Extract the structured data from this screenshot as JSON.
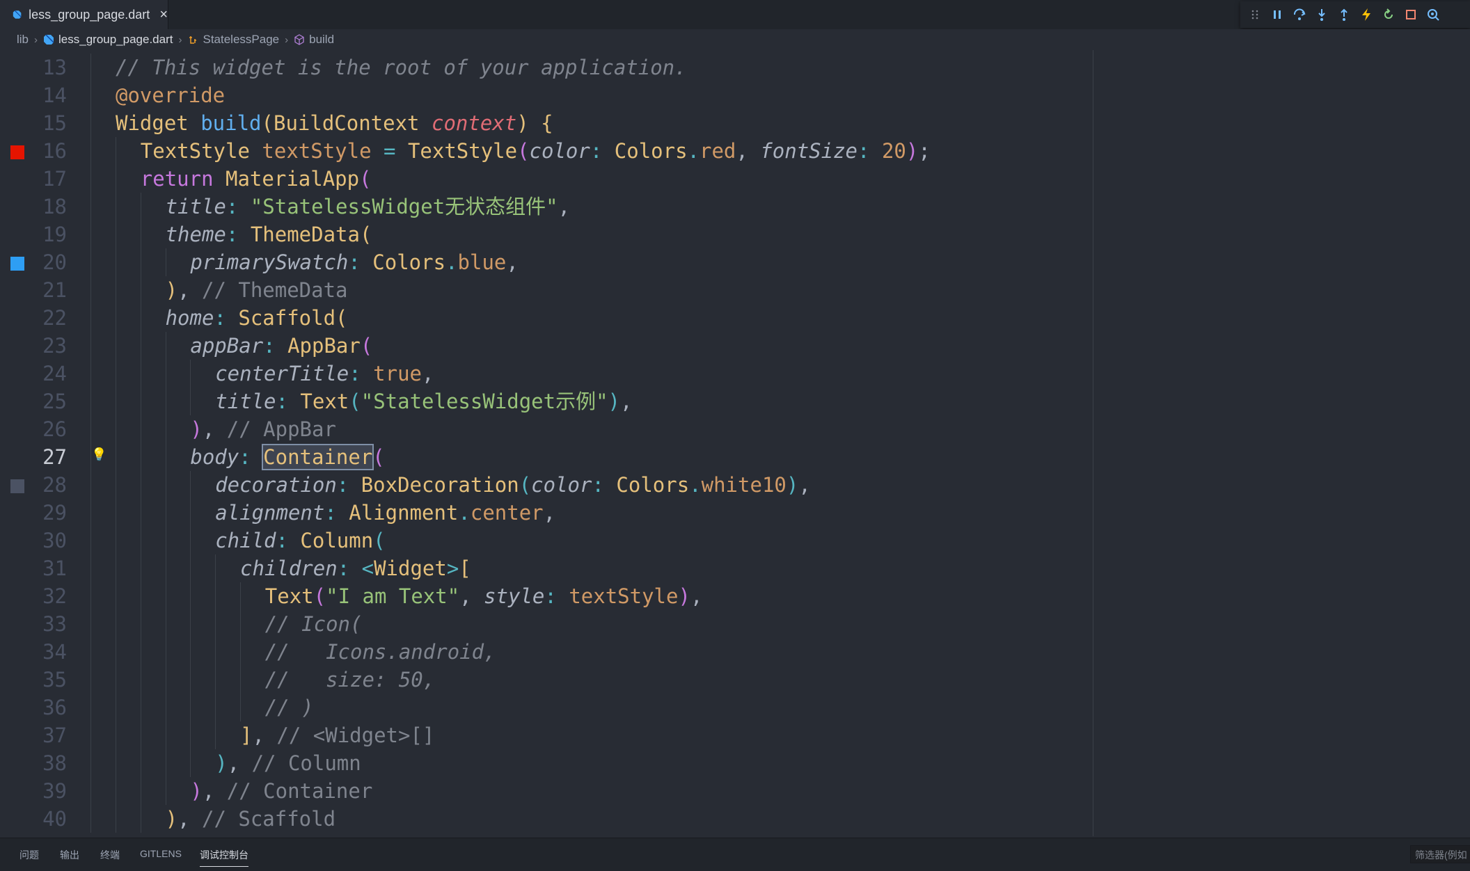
{
  "tab": {
    "label": "less_group_page.dart"
  },
  "breadcrumb": {
    "items": [
      {
        "label": "lib"
      },
      {
        "label": "less_group_page.dart"
      },
      {
        "label": "StatelessPage"
      },
      {
        "label": "build"
      }
    ]
  },
  "debug_toolbar": {
    "icons": [
      "drag-handle-icon",
      "pause-icon",
      "step-over-icon",
      "step-into-icon",
      "step-out-icon",
      "hot-reload-icon",
      "restart-icon",
      "stop-icon",
      "inspect-widget-icon"
    ]
  },
  "editor": {
    "active_line": "27",
    "lines": [
      {
        "no": "13",
        "indent": 1,
        "marker": "",
        "tokens": [
          {
            "t": "// This widget is the root of your application.",
            "c": "t-com"
          }
        ]
      },
      {
        "no": "14",
        "indent": 1,
        "marker": "",
        "tokens": [
          {
            "t": "@override",
            "c": "t-ann"
          }
        ]
      },
      {
        "no": "15",
        "indent": 1,
        "marker": "",
        "tokens": [
          {
            "t": "Widget ",
            "c": "t-cls"
          },
          {
            "t": "build",
            "c": "t-fn"
          },
          {
            "t": "(",
            "c": "t-p1"
          },
          {
            "t": "BuildContext ",
            "c": "t-cls"
          },
          {
            "t": "context",
            "c": "t-param"
          },
          {
            "t": ") ",
            "c": "t-p1"
          },
          {
            "t": "{",
            "c": "t-p1"
          }
        ]
      },
      {
        "no": "16",
        "indent": 2,
        "marker": "breakpoint-red",
        "tokens": [
          {
            "t": "TextStyle ",
            "c": "t-cls"
          },
          {
            "t": "textStyle ",
            "c": "t-prop"
          },
          {
            "t": "= ",
            "c": "t-op"
          },
          {
            "t": "TextStyle",
            "c": "t-cls"
          },
          {
            "t": "(",
            "c": "t-p2"
          },
          {
            "t": "color",
            "c": "t-named"
          },
          {
            "t": ": ",
            "c": "t-op"
          },
          {
            "t": "Colors",
            "c": "t-cls"
          },
          {
            "t": ".",
            "c": "t-op"
          },
          {
            "t": "red",
            "c": "t-prop"
          },
          {
            "t": ", ",
            "c": ""
          },
          {
            "t": "fontSize",
            "c": "t-named"
          },
          {
            "t": ": ",
            "c": "t-op"
          },
          {
            "t": "20",
            "c": "t-num"
          },
          {
            "t": ")",
            "c": "t-p2"
          },
          {
            "t": ";",
            "c": ""
          }
        ]
      },
      {
        "no": "17",
        "indent": 2,
        "marker": "",
        "tokens": [
          {
            "t": "return ",
            "c": "t-kw"
          },
          {
            "t": "MaterialApp",
            "c": "t-cls"
          },
          {
            "t": "(",
            "c": "t-p2"
          }
        ]
      },
      {
        "no": "18",
        "indent": 3,
        "marker": "",
        "tokens": [
          {
            "t": "title",
            "c": "t-named"
          },
          {
            "t": ": ",
            "c": "t-op"
          },
          {
            "t": "\"StatelessWidget无状态组件\"",
            "c": "t-str"
          },
          {
            "t": ",",
            "c": ""
          }
        ]
      },
      {
        "no": "19",
        "indent": 3,
        "marker": "",
        "tokens": [
          {
            "t": "theme",
            "c": "t-named"
          },
          {
            "t": ": ",
            "c": "t-op"
          },
          {
            "t": "ThemeData",
            "c": "t-cls"
          },
          {
            "t": "(",
            "c": "t-p1"
          }
        ]
      },
      {
        "no": "20",
        "indent": 4,
        "marker": "breakpoint-blue",
        "tokens": [
          {
            "t": "primarySwatch",
            "c": "t-named"
          },
          {
            "t": ": ",
            "c": "t-op"
          },
          {
            "t": "Colors",
            "c": "t-cls"
          },
          {
            "t": ".",
            "c": "t-op"
          },
          {
            "t": "blue",
            "c": "t-prop"
          },
          {
            "t": ",",
            "c": ""
          }
        ]
      },
      {
        "no": "21",
        "indent": 3,
        "marker": "",
        "tokens": [
          {
            "t": ")",
            "c": "t-p1"
          },
          {
            "t": ", ",
            "c": ""
          },
          {
            "t": "// ThemeData",
            "c": "t-hint"
          }
        ]
      },
      {
        "no": "22",
        "indent": 3,
        "marker": "",
        "tokens": [
          {
            "t": "home",
            "c": "t-named"
          },
          {
            "t": ": ",
            "c": "t-op"
          },
          {
            "t": "Scaffold",
            "c": "t-cls"
          },
          {
            "t": "(",
            "c": "t-p1"
          }
        ]
      },
      {
        "no": "23",
        "indent": 4,
        "marker": "",
        "tokens": [
          {
            "t": "appBar",
            "c": "t-named"
          },
          {
            "t": ": ",
            "c": "t-op"
          },
          {
            "t": "AppBar",
            "c": "t-cls"
          },
          {
            "t": "(",
            "c": "t-p2"
          }
        ]
      },
      {
        "no": "24",
        "indent": 5,
        "marker": "",
        "tokens": [
          {
            "t": "centerTitle",
            "c": "t-named"
          },
          {
            "t": ": ",
            "c": "t-op"
          },
          {
            "t": "true",
            "c": "t-num"
          },
          {
            "t": ",",
            "c": ""
          }
        ]
      },
      {
        "no": "25",
        "indent": 5,
        "marker": "",
        "tokens": [
          {
            "t": "title",
            "c": "t-named"
          },
          {
            "t": ": ",
            "c": "t-op"
          },
          {
            "t": "Text",
            "c": "t-cls"
          },
          {
            "t": "(",
            "c": "t-p3"
          },
          {
            "t": "\"StatelessWidget示例\"",
            "c": "t-str"
          },
          {
            "t": ")",
            "c": "t-p3"
          },
          {
            "t": ",",
            "c": ""
          }
        ]
      },
      {
        "no": "26",
        "indent": 4,
        "marker": "",
        "tokens": [
          {
            "t": ")",
            "c": "t-p2"
          },
          {
            "t": ", ",
            "c": ""
          },
          {
            "t": "// AppBar",
            "c": "t-hint"
          }
        ]
      },
      {
        "no": "27",
        "indent": 4,
        "marker": "",
        "bulb": true,
        "tokens": [
          {
            "t": "body",
            "c": "t-named"
          },
          {
            "t": ": ",
            "c": "t-op"
          },
          {
            "t": "Container",
            "c": "t-cls t-sel"
          },
          {
            "t": "(",
            "c": "t-p2"
          }
        ]
      },
      {
        "no": "28",
        "indent": 5,
        "marker": "breakpoint-gray",
        "tokens": [
          {
            "t": "decoration",
            "c": "t-named"
          },
          {
            "t": ": ",
            "c": "t-op"
          },
          {
            "t": "BoxDecoration",
            "c": "t-cls"
          },
          {
            "t": "(",
            "c": "t-p3"
          },
          {
            "t": "color",
            "c": "t-named"
          },
          {
            "t": ": ",
            "c": "t-op"
          },
          {
            "t": "Colors",
            "c": "t-cls"
          },
          {
            "t": ".",
            "c": "t-op"
          },
          {
            "t": "white10",
            "c": "t-prop"
          },
          {
            "t": ")",
            "c": "t-p3"
          },
          {
            "t": ",",
            "c": ""
          }
        ]
      },
      {
        "no": "29",
        "indent": 5,
        "marker": "",
        "tokens": [
          {
            "t": "alignment",
            "c": "t-named"
          },
          {
            "t": ": ",
            "c": "t-op"
          },
          {
            "t": "Alignment",
            "c": "t-cls"
          },
          {
            "t": ".",
            "c": "t-op"
          },
          {
            "t": "center",
            "c": "t-prop"
          },
          {
            "t": ",",
            "c": ""
          }
        ]
      },
      {
        "no": "30",
        "indent": 5,
        "marker": "",
        "tokens": [
          {
            "t": "child",
            "c": "t-named"
          },
          {
            "t": ": ",
            "c": "t-op"
          },
          {
            "t": "Column",
            "c": "t-cls"
          },
          {
            "t": "(",
            "c": "t-p3"
          }
        ]
      },
      {
        "no": "31",
        "indent": 6,
        "marker": "",
        "tokens": [
          {
            "t": "children",
            "c": "t-named"
          },
          {
            "t": ": ",
            "c": "t-op"
          },
          {
            "t": "<",
            "c": "t-op"
          },
          {
            "t": "Widget",
            "c": "t-cls"
          },
          {
            "t": ">",
            "c": "t-op"
          },
          {
            "t": "[",
            "c": "t-p1"
          }
        ]
      },
      {
        "no": "32",
        "indent": 7,
        "marker": "",
        "tokens": [
          {
            "t": "Text",
            "c": "t-cls"
          },
          {
            "t": "(",
            "c": "t-p2"
          },
          {
            "t": "\"I am Text\"",
            "c": "t-str"
          },
          {
            "t": ", ",
            "c": ""
          },
          {
            "t": "style",
            "c": "t-named"
          },
          {
            "t": ": ",
            "c": "t-op"
          },
          {
            "t": "textStyle",
            "c": "t-prop"
          },
          {
            "t": ")",
            "c": "t-p2"
          },
          {
            "t": ",",
            "c": ""
          }
        ]
      },
      {
        "no": "33",
        "indent": 7,
        "marker": "",
        "tokens": [
          {
            "t": "// Icon(",
            "c": "t-com"
          }
        ]
      },
      {
        "no": "34",
        "indent": 7,
        "marker": "",
        "tokens": [
          {
            "t": "//   Icons.android,",
            "c": "t-com"
          }
        ]
      },
      {
        "no": "35",
        "indent": 7,
        "marker": "",
        "tokens": [
          {
            "t": "//   size: 50,",
            "c": "t-com"
          }
        ]
      },
      {
        "no": "36",
        "indent": 7,
        "marker": "",
        "tokens": [
          {
            "t": "// )",
            "c": "t-com"
          }
        ]
      },
      {
        "no": "37",
        "indent": 6,
        "marker": "",
        "tokens": [
          {
            "t": "]",
            "c": "t-p1"
          },
          {
            "t": ", ",
            "c": ""
          },
          {
            "t": "// <Widget>[]",
            "c": "t-hint"
          }
        ]
      },
      {
        "no": "38",
        "indent": 5,
        "marker": "",
        "tokens": [
          {
            "t": ")",
            "c": "t-p3"
          },
          {
            "t": ", ",
            "c": ""
          },
          {
            "t": "// Column",
            "c": "t-hint"
          }
        ]
      },
      {
        "no": "39",
        "indent": 4,
        "marker": "",
        "tokens": [
          {
            "t": ")",
            "c": "t-p2"
          },
          {
            "t": ", ",
            "c": ""
          },
          {
            "t": "// Container",
            "c": "t-hint"
          }
        ]
      },
      {
        "no": "40",
        "indent": 3,
        "marker": "",
        "tokens": [
          {
            "t": ")",
            "c": "t-p1"
          },
          {
            "t": ", ",
            "c": ""
          },
          {
            "t": "// Scaffold",
            "c": "t-hint"
          }
        ]
      }
    ]
  },
  "panel": {
    "tabs": [
      {
        "label": "问题"
      },
      {
        "label": "输出"
      },
      {
        "label": "终端"
      },
      {
        "label": "GITLENS"
      },
      {
        "label": "调试控制台"
      }
    ],
    "active_tab": "调试控制台",
    "filter_placeholder": "筛选器(例如"
  },
  "colors": {
    "breakpoint_red": "#e51400",
    "breakpoint_blue": "#2e9ef4",
    "breakpoint_gray": "#4b5263",
    "background": "#282c34"
  }
}
